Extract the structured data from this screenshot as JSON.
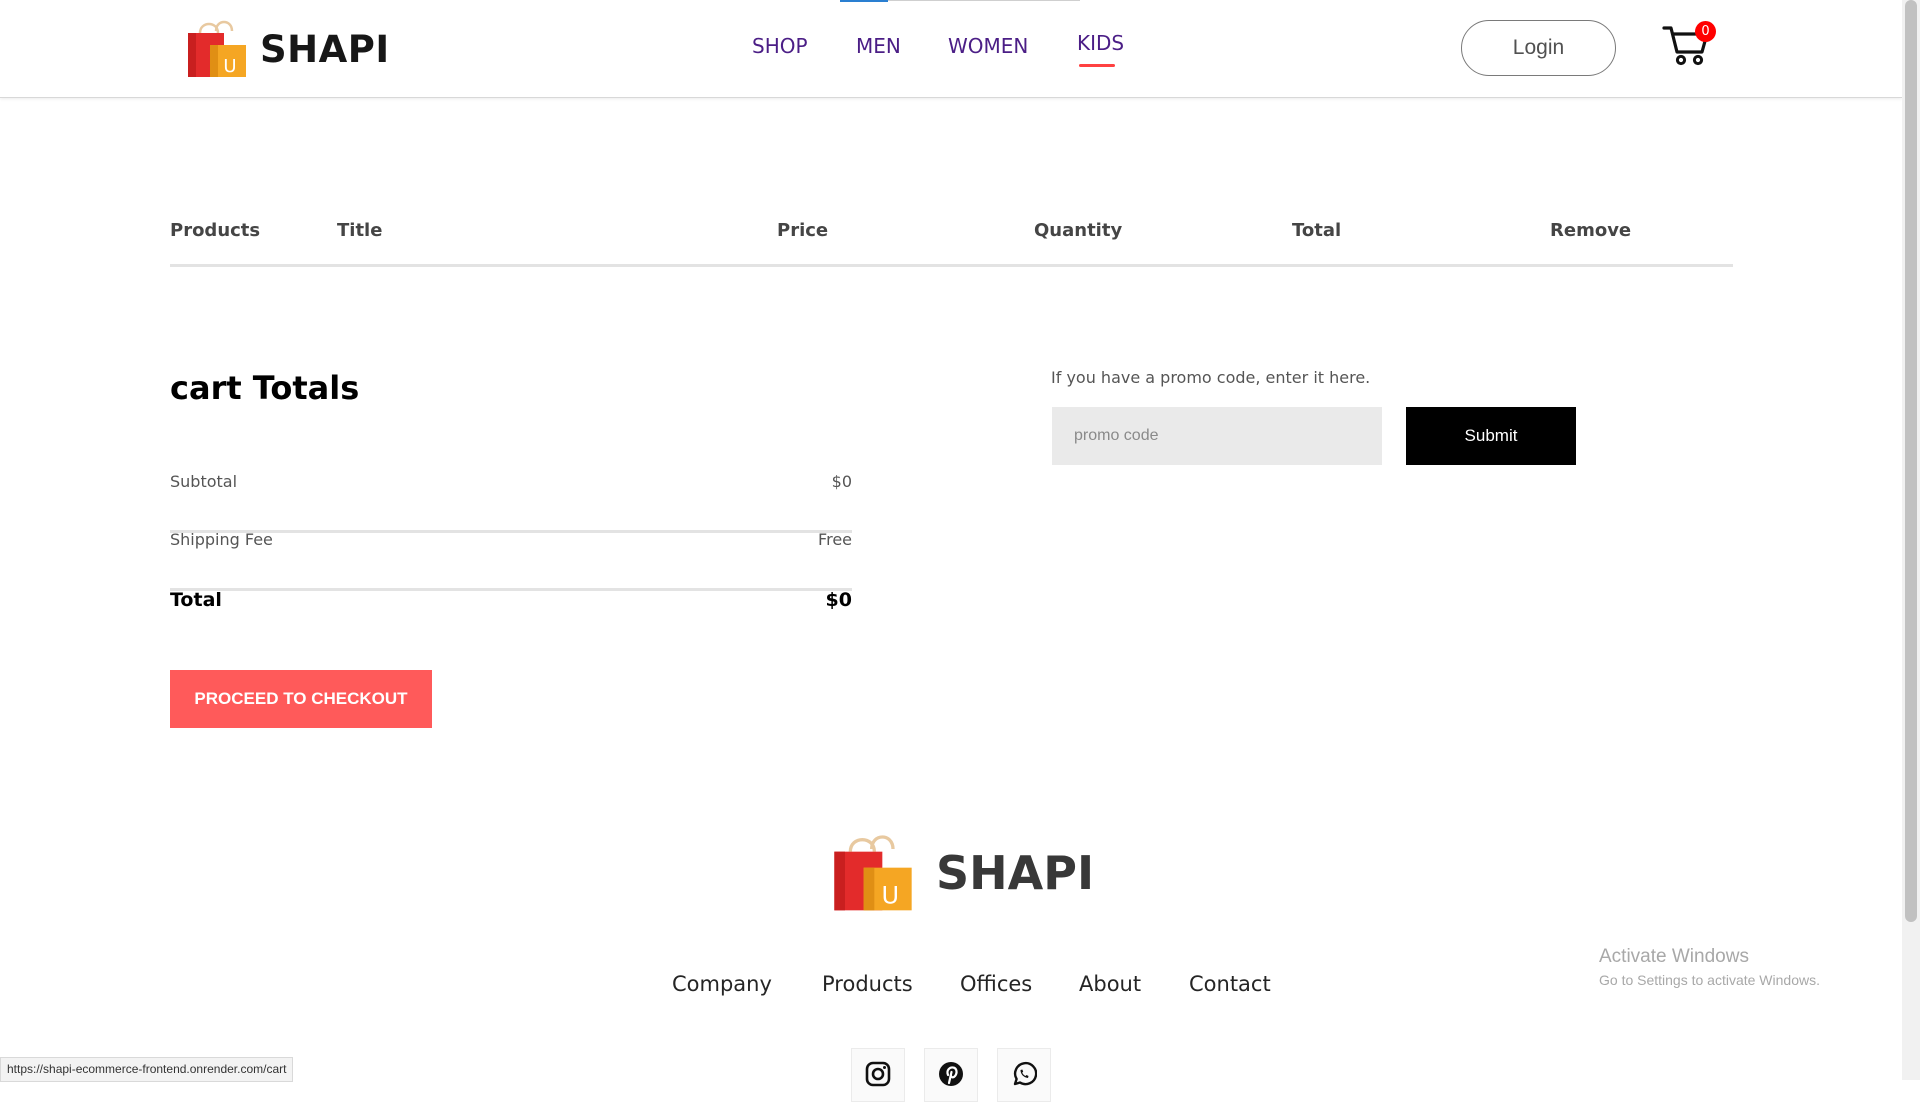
{
  "header": {
    "brand": "SHAPI",
    "nav": [
      {
        "label": "SHOP"
      },
      {
        "label": "MEN"
      },
      {
        "label": "WOMEN"
      },
      {
        "label": "KIDS",
        "active": true
      }
    ],
    "login_label": "Login",
    "cart_count": "0",
    "accent_color": "#ff4141",
    "nav_color": "#4b1e86"
  },
  "cart_table": {
    "columns": [
      "Products",
      "Title",
      "Price",
      "Quantity",
      "Total",
      "Remove"
    ],
    "rows": []
  },
  "totals": {
    "title": "cart Totals",
    "subtotal_label": "Subtotal",
    "subtotal_value": "$0",
    "shipping_label": "Shipping Fee",
    "shipping_value": "Free",
    "total_label": "Total",
    "total_value": "$0",
    "checkout_label": "PROCEED TO CHECKOUT",
    "checkout_color": "#ff5a5a"
  },
  "promo": {
    "prompt": "If you have a promo code, enter it here.",
    "placeholder": "promo code",
    "value": "",
    "submit_label": "Submit"
  },
  "footer": {
    "brand": "SHAPI",
    "links": [
      "Company",
      "Products",
      "Offices",
      "About",
      "Contact"
    ],
    "social_icons": [
      "instagram-icon",
      "pinterest-icon",
      "whatsapp-icon"
    ]
  },
  "system": {
    "activate_title": "Activate Windows",
    "activate_sub": "Go to Settings to activate Windows.",
    "status_url": "https://shapi-ecommerce-frontend.onrender.com/cart"
  }
}
